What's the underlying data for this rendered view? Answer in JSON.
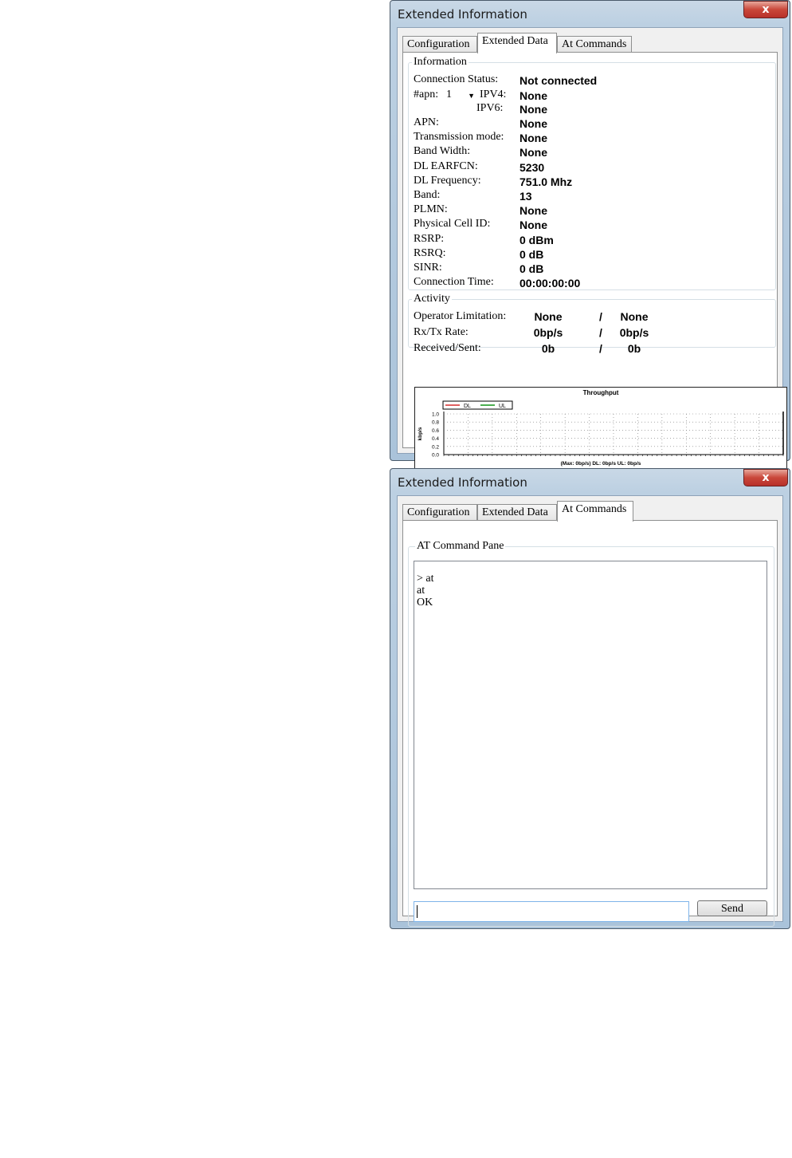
{
  "window1": {
    "title": "Extended Information",
    "close": "x",
    "tabs": [
      {
        "label": "Configuration",
        "active": false
      },
      {
        "label": "Extended Data",
        "active": true
      },
      {
        "label": "At Commands",
        "active": false
      }
    ],
    "information": {
      "legend": "Information",
      "connection_status": {
        "label": "Connection Status:",
        "value": "Not connected"
      },
      "apn_select": {
        "label": "#apn:",
        "value": "1"
      },
      "ipv4": {
        "label": "IPV4:",
        "value": "None"
      },
      "ipv6": {
        "label": "IPV6:",
        "value": "None"
      },
      "rows": [
        {
          "label": "APN:",
          "value": "None"
        },
        {
          "label": "Transmission mode:",
          "value": "None"
        },
        {
          "label": "Band Width:",
          "value": "None"
        },
        {
          "label": "DL EARFCN:",
          "value": "5230"
        },
        {
          "label": "DL Frequency:",
          "value": "751.0 Mhz"
        },
        {
          "label": "Band:",
          "value": "13"
        },
        {
          "label": "PLMN:",
          "value": "None"
        },
        {
          "label": "Physical Cell ID:",
          "value": "None"
        },
        {
          "label": "RSRP:",
          "value": "0 dBm"
        },
        {
          "label": "RSRQ:",
          "value": "0 dB"
        },
        {
          "label": "SINR:",
          "value": "0 dB"
        },
        {
          "label": "Connection Time:",
          "value": "00:00:00:00"
        }
      ]
    },
    "activity": {
      "legend": "Activity",
      "rows": [
        {
          "label": "Operator Limitation:",
          "left": "None",
          "sep": "/",
          "right": "None"
        },
        {
          "label": "Rx/Tx Rate:",
          "left": "0bp/s",
          "sep": "/",
          "right": "0bp/s"
        },
        {
          "label": "Received/Sent:",
          "left": "0b",
          "sep": "/",
          "right": "0b"
        }
      ]
    },
    "throughput": {
      "title": "Throughput",
      "legend_dl": "DL",
      "legend_ul": "UL",
      "dl_color": "#e06060",
      "ul_color": "#4caf50",
      "ylabel": "kbp/s",
      "footer": "(Max: 0bp/s) DL: 0bp/s UL: 0bp/s"
    }
  },
  "window2": {
    "title": "Extended Information",
    "close": "x",
    "tabs": [
      {
        "label": "Configuration",
        "active": false
      },
      {
        "label": "Extended Data",
        "active": false
      },
      {
        "label": "At Commands",
        "active": true
      }
    ],
    "at_pane": {
      "legend": "AT Command Pane",
      "output_lines": [
        "> at",
        "at",
        "OK"
      ],
      "input_value": "",
      "send_label": "Send"
    }
  },
  "chart_data": {
    "type": "line",
    "title": "Throughput",
    "ylabel": "kbp/s",
    "x": [],
    "series": [
      {
        "name": "DL",
        "values": []
      },
      {
        "name": "UL",
        "values": []
      }
    ],
    "ylim": [
      0.0,
      1.0
    ],
    "yticks": [
      "1.0",
      "0.8",
      "0.6",
      "0.4",
      "0.2",
      "0.0"
    ],
    "grid": true,
    "legend_position": "top-left",
    "footer": "(Max: 0bp/s) DL: 0bp/s UL: 0bp/s"
  }
}
